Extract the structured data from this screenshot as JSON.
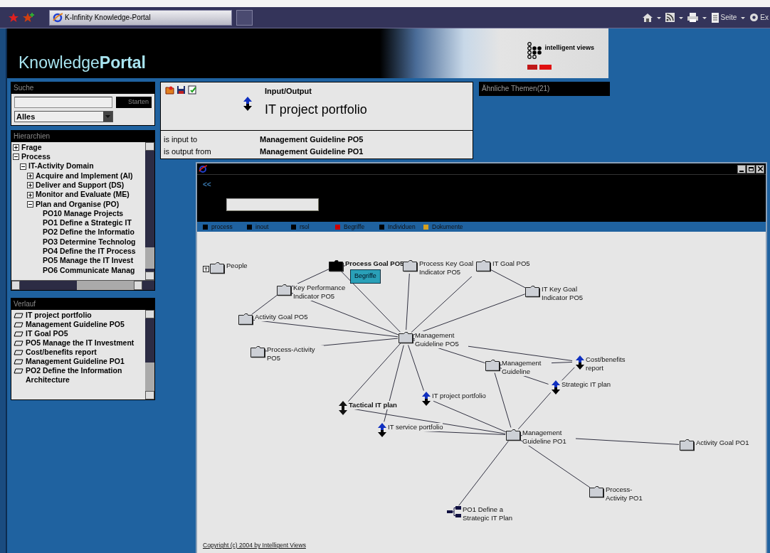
{
  "browser": {
    "tab_title": "K-Infinity Knowledge-Portal",
    "toolbar": [
      "Seite",
      "Ex"
    ]
  },
  "header": {
    "brand_light": "Knowledge",
    "brand_bold": "Portal",
    "logo_text": "intelligent views"
  },
  "search": {
    "title": "Suche",
    "button": "Starten",
    "scope": "Alles"
  },
  "hierarchy": {
    "title": "Hierarchien",
    "items": [
      {
        "label": "Frage",
        "kind": "group",
        "expanded": false
      },
      {
        "label": "Process",
        "kind": "group",
        "expanded": true,
        "children": [
          {
            "label": "IT-Activity Domain",
            "kind": "group",
            "expanded": true,
            "children": [
              {
                "label": "Acquire and Implement (AI)",
                "kind": "group",
                "expanded": false
              },
              {
                "label": "Deliver and Support (DS)",
                "kind": "group",
                "expanded": false
              },
              {
                "label": "Monitor and Evaluate (ME)",
                "kind": "group",
                "expanded": false
              },
              {
                "label": "Plan and Organise (PO)",
                "kind": "group",
                "expanded": true,
                "children": [
                  {
                    "label": "PO10 Manage Projects",
                    "kind": "leaf"
                  },
                  {
                    "label": "PO1 Define a Strategic IT",
                    "kind": "leaf"
                  },
                  {
                    "label": "PO2 Define the Informatio",
                    "kind": "leaf"
                  },
                  {
                    "label": "PO3 Determine Technolog",
                    "kind": "leaf"
                  },
                  {
                    "label": "PO4 Define the IT Process",
                    "kind": "leaf"
                  },
                  {
                    "label": "PO5 Manage the IT Invest",
                    "kind": "leaf"
                  },
                  {
                    "label": "PO6 Communicate Manag",
                    "kind": "leaf"
                  }
                ]
              }
            ]
          }
        ]
      }
    ]
  },
  "history": {
    "title": "Verlauf",
    "items": [
      "IT project portfolio",
      "Management Guideline PO5",
      "IT Goal PO5",
      "PO5 Manage the IT Investment",
      "Cost/benefits report",
      "Management Guideline PO1",
      "PO2 Define the Information Architecture"
    ]
  },
  "topic": {
    "type": "Input/Output",
    "name": "IT project portfolio",
    "relations": [
      {
        "label": "is input to",
        "value": "Management Guideline PO5"
      },
      {
        "label": "is output from",
        "value": "Management Guideline PO1"
      }
    ]
  },
  "similar_topics": {
    "title": "Ähnliche Themen(21)"
  },
  "graph": {
    "back": "<<",
    "legend": [
      {
        "label": "process",
        "color": "#000000"
      },
      {
        "label": "inout",
        "color": "#000000"
      },
      {
        "label": "rsol",
        "color": "#000000"
      },
      {
        "label": "Begriffe",
        "color": "#cc0000"
      },
      {
        "label": "Individuen",
        "color": "#000000"
      },
      {
        "label": "Dokumente",
        "color": "#d4a020"
      }
    ],
    "nodes": [
      {
        "label": "People",
        "kind": "folder-tagged",
        "bold": false
      },
      {
        "label": "Process Goal PO5",
        "kind": "folder-dark",
        "bold": true,
        "tooltip": "Begriffe"
      },
      {
        "label": "Process Key Goal Indicator PO5",
        "kind": "folder",
        "bold": false
      },
      {
        "label": "IT Goal PO5",
        "kind": "folder",
        "bold": false
      },
      {
        "label": "Key Performance Indicator PO5",
        "kind": "folder",
        "bold": false
      },
      {
        "label": "IT Key Goal Indicator PO5",
        "kind": "folder",
        "bold": false
      },
      {
        "label": "Activity Goal PO5",
        "kind": "folder",
        "bold": false
      },
      {
        "label": "Management Guideline PO5",
        "kind": "folder",
        "bold": false
      },
      {
        "label": "Process-Activity PO5",
        "kind": "folder",
        "bold": false
      },
      {
        "label": "Management Guideline",
        "kind": "folder",
        "bold": false
      },
      {
        "label": "Cost/benefits report",
        "kind": "io",
        "bold": false
      },
      {
        "label": "Strategic IT plan",
        "kind": "io",
        "bold": false
      },
      {
        "label": "IT project portfolio",
        "kind": "io",
        "bold": false
      },
      {
        "label": "Tactical IT plan",
        "kind": "io-dark",
        "bold": true
      },
      {
        "label": "IT service portfolio",
        "kind": "io",
        "bold": false
      },
      {
        "label": "Management Guideline PO1",
        "kind": "folder",
        "bold": false
      },
      {
        "label": "Activity Goal PO1",
        "kind": "folder",
        "bold": false
      },
      {
        "label": "Process-Activity PO1",
        "kind": "folder",
        "bold": false
      },
      {
        "label": "PO1 Define a Strategic IT Plan",
        "kind": "tree",
        "bold": false
      }
    ],
    "copyright": "Copyright (c) 2004 by Intelligent Views"
  }
}
